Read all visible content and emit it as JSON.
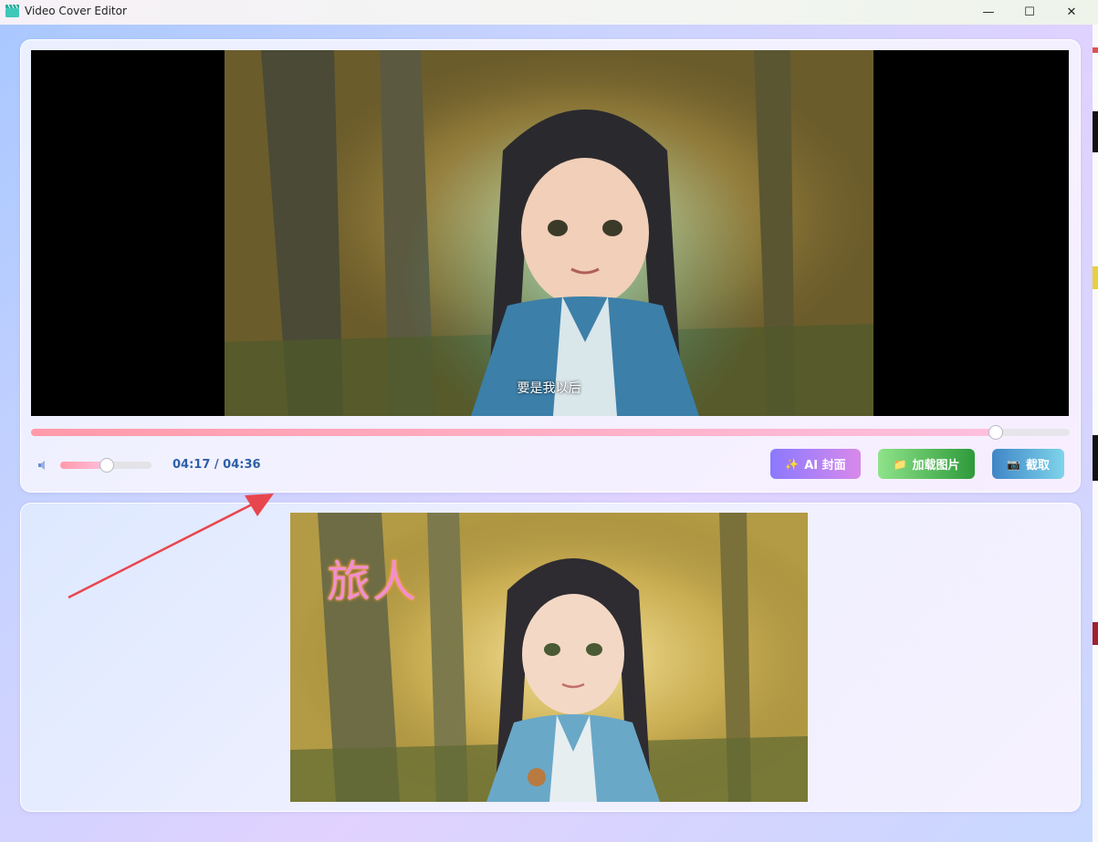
{
  "window": {
    "title": "Video Cover Editor",
    "minimize_glyph": "—",
    "maximize_glyph": "☐",
    "close_glyph": "✕"
  },
  "player": {
    "subtitle": "要是我以后",
    "progress_fraction": 0.928,
    "volume_fraction": 0.5,
    "time_display": "04:17 / 04:36"
  },
  "buttons": {
    "ai_cover": {
      "label": "AI 封面",
      "icon": "sparkle-icon",
      "glyph": "✨"
    },
    "load_image": {
      "label": "加载图片",
      "icon": "folder-icon",
      "glyph": "📁"
    },
    "capture": {
      "label": "截取",
      "icon": "camera-icon",
      "glyph": "📷"
    }
  },
  "cover": {
    "title_text": "旅人"
  },
  "colors": {
    "accent_time": "#2f5fa8",
    "arrow": "#e8464e",
    "progress_fill": "#ff9aa9"
  }
}
